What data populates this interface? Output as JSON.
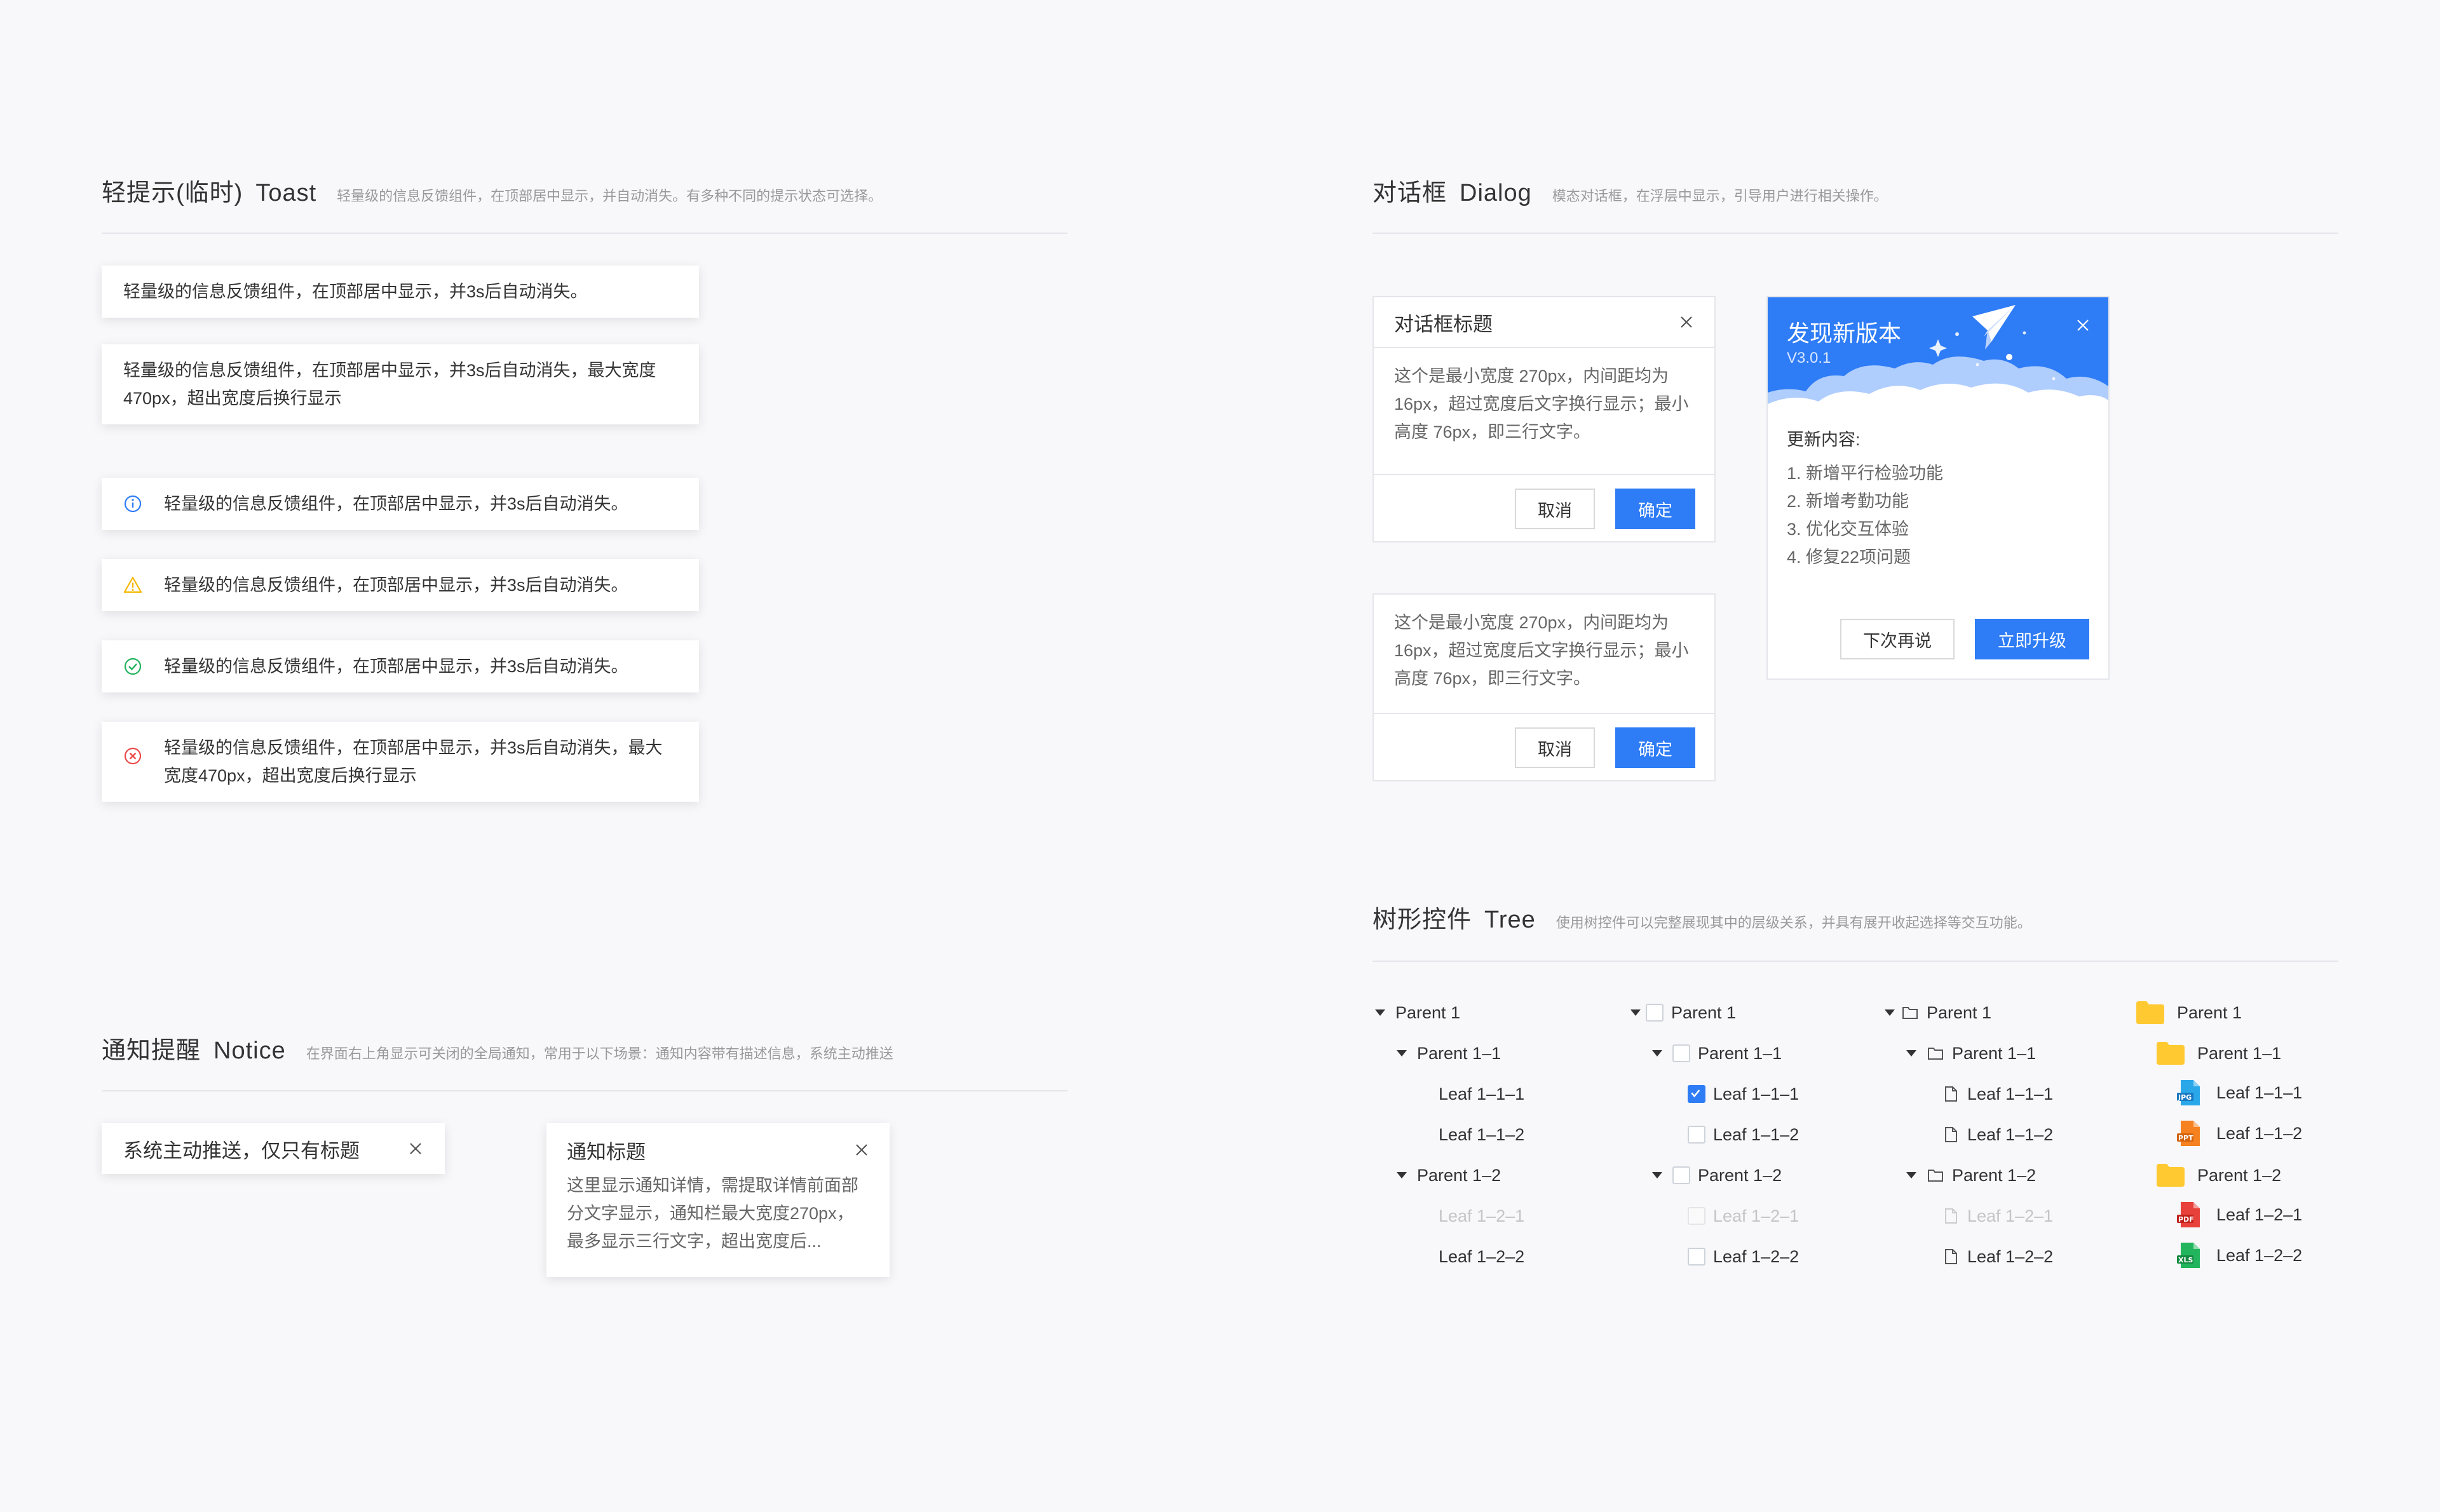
{
  "toast": {
    "title_cn": "轻提示(临时)",
    "title_en": "Toast",
    "desc": "轻量级的信息反馈组件，在顶部居中显示，并自动消失。有多种不同的提示状态可选择。",
    "items": [
      "轻量级的信息反馈组件，在顶部居中显示，并3s后自动消失。",
      "轻量级的信息反馈组件，在顶部居中显示，并3s后自动消失，最大宽度470px，超出宽度后换行显示",
      "轻量级的信息反馈组件，在顶部居中显示，并3s后自动消失。",
      "轻量级的信息反馈组件，在顶部居中显示，并3s后自动消失。",
      "轻量级的信息反馈组件，在顶部居中显示，并3s后自动消失。",
      "轻量级的信息反馈组件，在顶部居中显示，并3s后自动消失，最大宽度470px，超出宽度后换行显示"
    ]
  },
  "notice": {
    "title_cn": "通知提醒",
    "title_en": "Notice",
    "desc": "在界面右上角显示可关闭的全局通知，常用于以下场景：通知内容带有描述信息，系统主动推送",
    "simple": "系统主动推送，仅只有标题",
    "card_title": "通知标题",
    "card_body": "这里显示通知详情，需提取详情前面部分文字显示，通知栏最大宽度270px，最多显示三行文字，超出宽度后..."
  },
  "dialog": {
    "title_cn": "对话框",
    "title_en": "Dialog",
    "desc": "模态对话框，在浮层中显示，引导用户进行相关操作。",
    "head": "对话框标题",
    "body": "这个是最小宽度 270px，内间距均为16px，超过宽度后文字换行显示；最小高度 76px，即三行文字。",
    "cancel": "取消",
    "ok": "确定",
    "update": {
      "title": "发现新版本",
      "version": "V3.0.1",
      "label": "更新内容:",
      "items": [
        "1. 新增平行检验功能",
        "2. 新增考勤功能",
        "3. 优化交互体验",
        "4. 修复22项问题"
      ],
      "later": "下次再说",
      "upgrade": "立即升级"
    }
  },
  "tree": {
    "title_cn": "树形控件",
    "title_en": "Tree",
    "desc": "使用树控件可以完整展现其中的层级关系，并具有展开收起选择等交互功能。",
    "nodes": [
      "Parent 1",
      "Parent 1–1",
      "Leaf 1–1–1",
      "Leaf 1–1–2",
      "Parent 1–2",
      "Leaf 1–2–1",
      "Leaf 1–2–2"
    ],
    "file_types": [
      "JPG",
      "PPT",
      "PDF",
      "XLS"
    ]
  },
  "colors": {
    "primary": "#2e7cf6",
    "info": "#2e7cf6",
    "warning": "#f5b800",
    "success": "#21b35d",
    "error": "#ec4a4a",
    "folder": "#ffc931"
  }
}
